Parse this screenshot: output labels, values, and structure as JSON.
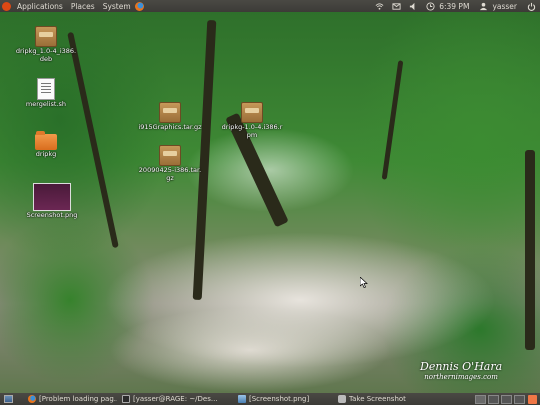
{
  "top_panel": {
    "menus": [
      "Applications",
      "Places",
      "System"
    ],
    "clock": "6:39 PM",
    "user": "yasser"
  },
  "desktop_icons": [
    {
      "label": "dripkg_1.0-4_i386.deb",
      "kind": "package"
    },
    {
      "label": "mergelist.sh",
      "kind": "script"
    },
    {
      "label": "dripkg",
      "kind": "folder"
    },
    {
      "label": "Screenshot.png",
      "kind": "image"
    },
    {
      "label": "i915Graphics.tar.gz",
      "kind": "package"
    },
    {
      "label": "dripkg-1.0-4.i386.rpm",
      "kind": "package"
    },
    {
      "label": "20090425-i386.tar.gz",
      "kind": "package"
    }
  ],
  "taskbar": {
    "tasks": [
      {
        "label": "[Problem loading pag...",
        "icon": "firefox-icon"
      },
      {
        "label": "[yasser@RAGE: ~/Des...",
        "icon": "terminal-icon"
      },
      {
        "label": "[Screenshot.png]",
        "icon": "image-viewer-icon"
      },
      {
        "label": "Take Screenshot",
        "icon": "camera-icon"
      }
    ]
  },
  "watermark": {
    "line1": "Dennis O'Hara",
    "line2": "northernimages.com"
  },
  "colors": {
    "panel": "#3c3b37",
    "panel_text": "#dfdbd2",
    "notification": "#f07746"
  }
}
